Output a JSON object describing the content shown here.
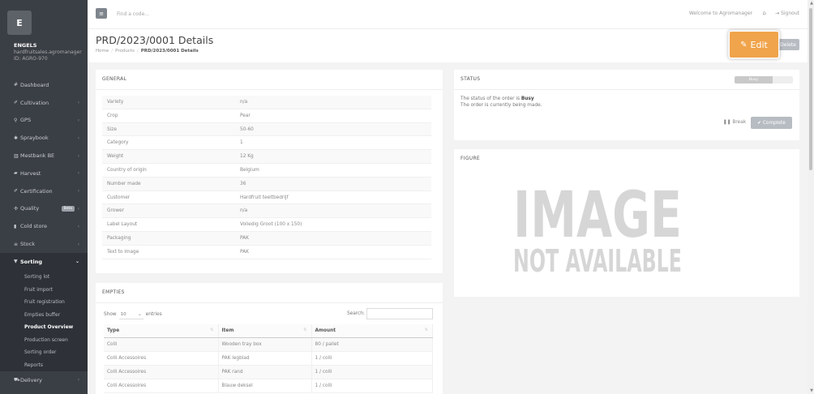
{
  "sidebar": {
    "logo_letter": "E",
    "user_name": "ENGELS",
    "user_email": "hardfruitsales.agromanager",
    "user_id": "ID: AGRO-970",
    "items": [
      {
        "icon": "#",
        "label": "Dashboard",
        "chevron": ""
      },
      {
        "icon": "✐",
        "label": "Cultivation",
        "chevron": "‹"
      },
      {
        "icon": "⚲",
        "label": "GPS",
        "chevron": "‹"
      },
      {
        "icon": "✱",
        "label": "Spraybook",
        "chevron": "‹"
      },
      {
        "icon": "▥",
        "label": "Mestbank BE",
        "chevron": "‹"
      },
      {
        "icon": "▰",
        "label": "Harvest",
        "chevron": "‹"
      },
      {
        "icon": "✐",
        "label": "Certification",
        "chevron": "‹"
      },
      {
        "icon": "✣",
        "label": "Quality",
        "chevron": "‹",
        "badge": "Beta"
      },
      {
        "icon": "▮",
        "label": "Cold store",
        "chevron": "‹"
      },
      {
        "icon": "≡",
        "label": "Stock",
        "chevron": "‹"
      },
      {
        "icon": "▼",
        "label": "Sorting",
        "chevron": "⌄"
      }
    ],
    "sorting_sub": [
      "Sorting lot",
      "Fruit import",
      "Fruit registration",
      "Empties buffer",
      "Product Overview",
      "Production screen",
      "Sorting order",
      "Reports"
    ],
    "delivery": {
      "icon": "⛟",
      "label": "Delivery",
      "chevron": "‹"
    }
  },
  "topbar": {
    "menu_icon": "≡",
    "search_placeholder": "Find a code...",
    "welcome": "Welcome to Agromanager",
    "home_icon": "⌂",
    "signout": "⇥ Signout"
  },
  "header": {
    "title": "PRD/2023/0001 Details",
    "breadcrumb": [
      "Home",
      "Products",
      "PRD/2023/0001 Details"
    ],
    "edit_label": "Edit",
    "delete_label": "Delete"
  },
  "general": {
    "title": "GENERAL",
    "rows": [
      {
        "k": "Variety",
        "v": "n/a"
      },
      {
        "k": "Crop",
        "v": "Pear"
      },
      {
        "k": "Size",
        "v": "50-60"
      },
      {
        "k": "Category",
        "v": "1"
      },
      {
        "k": "Weight",
        "v": "12 Kg"
      },
      {
        "k": "Country of origin",
        "v": "Belgium"
      },
      {
        "k": "Number made",
        "v": "36"
      },
      {
        "k": "Customer",
        "v": "Hardfruit teeltbedrijf"
      },
      {
        "k": "Grower",
        "v": "n/a"
      },
      {
        "k": "Label Layout",
        "v": "Volledig Groot (100 x 150)"
      },
      {
        "k": "Packaging",
        "v": "PAK"
      },
      {
        "k": "Text to image",
        "v": "PAK"
      }
    ]
  },
  "empties": {
    "title": "EMPTIES",
    "show": "Show",
    "entries_value": "10",
    "entries": "entries",
    "search_label": "Search:",
    "columns": [
      "Type",
      "Item",
      "Amount"
    ],
    "rows": [
      [
        "Colli",
        "Wooden tray box",
        "80 / pallet"
      ],
      [
        "Colli Accessoires",
        "PAK legblad",
        "1 / colli"
      ],
      [
        "Colli Accessoires",
        "PAK rand",
        "1 / colli"
      ],
      [
        "Colli Accessoires",
        "Blauw deksel",
        "1 / colli"
      ]
    ]
  },
  "status": {
    "title": "STATUS",
    "badge": "Busy",
    "progress_fraction": 0.65,
    "line1_prefix": "The status of the order is ",
    "line1_value": "Busy",
    "line2": "The order is currently being made.",
    "break_label": "Break",
    "complete_label": "Complete"
  },
  "figure": {
    "title": "FIGURE",
    "image_text_1": "IMAGE",
    "image_text_2": "NOT AVAILABLE"
  },
  "colors": {
    "sidebar_bg": "#3a3e45",
    "edit_accent": "#f0a44b",
    "muted_button": "#b8bcc2"
  }
}
